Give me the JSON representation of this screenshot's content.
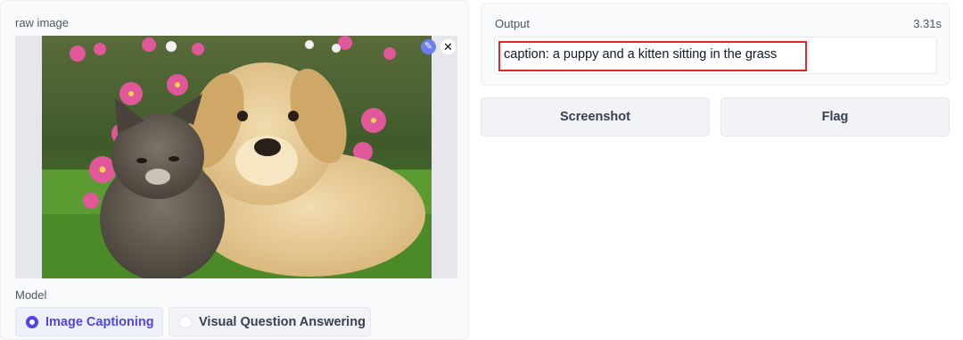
{
  "input": {
    "label": "raw image",
    "image_alt": "puppy and kitten sitting in the grass with pink flowers",
    "edit_icon": "pencil-icon",
    "close_icon": "close-icon"
  },
  "model": {
    "label": "Model",
    "options": [
      "Image Captioning",
      "Visual Question Answering"
    ],
    "selected": "Image Captioning"
  },
  "output": {
    "label": "Output",
    "time": "3.31s",
    "text": "caption: a puppy and a kitten sitting in the grass"
  },
  "buttons": {
    "screenshot": "Screenshot",
    "flag": "Flag"
  },
  "colors": {
    "accent": "#4f46e5",
    "highlight_border": "#e3252c"
  }
}
